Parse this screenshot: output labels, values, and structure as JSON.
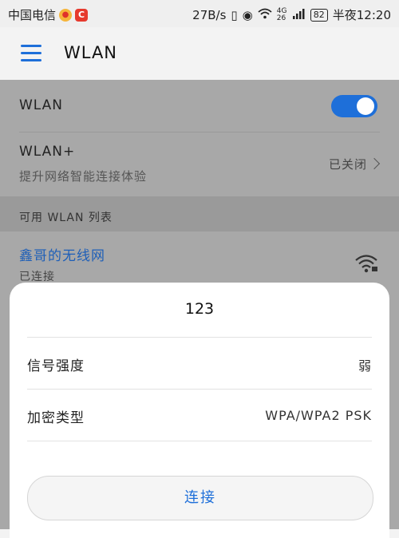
{
  "status_bar": {
    "carrier": "中国电信",
    "net_speed": "27B/s",
    "network_type": "4G 26",
    "battery": "82",
    "time": "半夜12:20"
  },
  "app_bar": {
    "title": "WLAN"
  },
  "wlan_toggle": {
    "label": "WLAN",
    "enabled": true
  },
  "wlan_plus": {
    "title": "WLAN+",
    "subtitle": "提升网络智能连接体验",
    "status": "已关闭"
  },
  "available_list": {
    "header": "可用 WLAN 列表"
  },
  "connected_network": {
    "name": "鑫哥的无线网",
    "status": "已连接"
  },
  "sheet": {
    "title": "123",
    "signal_label": "信号强度",
    "signal_value": "弱",
    "security_label": "加密类型",
    "security_value": "WPA/WPA2 PSK",
    "connect_button": "连接"
  },
  "colors": {
    "accent": "#1e6fd9",
    "dim_overlay": "#a8a8a8",
    "sheet_bg": "#ffffff"
  }
}
